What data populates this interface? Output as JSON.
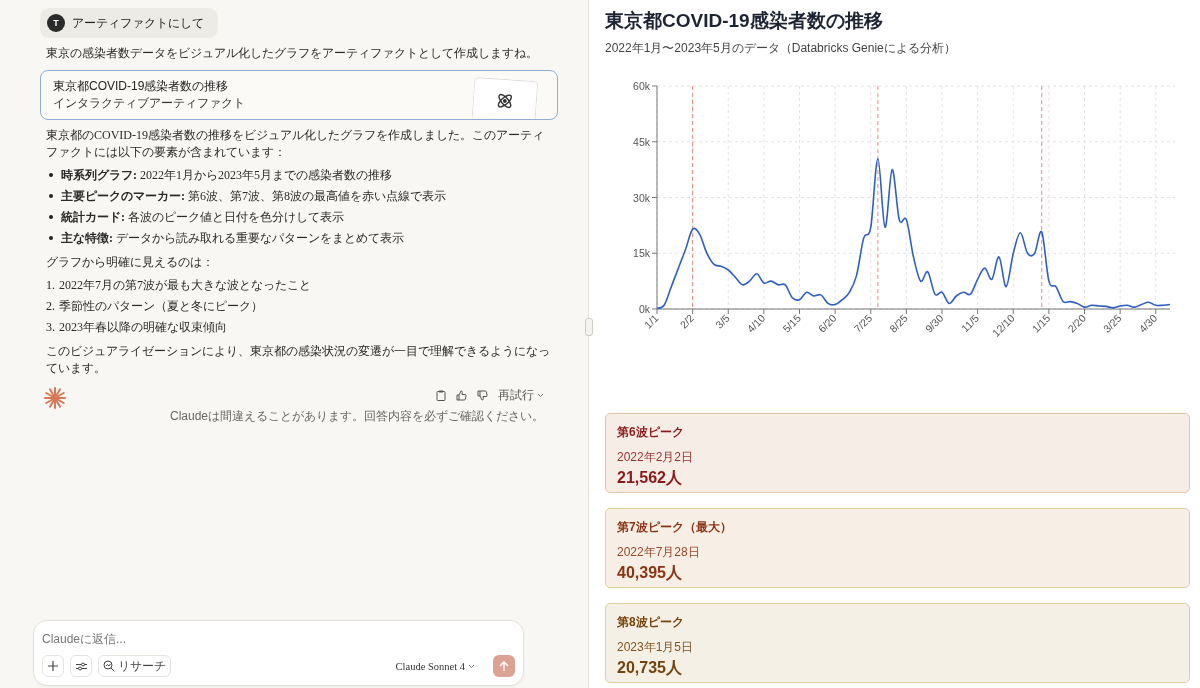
{
  "chat": {
    "user_message": {
      "avatar": "T",
      "text": "アーティファクトにして"
    },
    "assistant": {
      "intro": "東京の感染者数データをビジュアル化したグラフをアーティファクトとして作成しますね。",
      "artifact_card": {
        "title": "東京都COVID-19感染者数の推移",
        "subtitle": "インタラクティブアーティファクト"
      },
      "paragraph": "東京都のCOVID-19感染者数の推移をビジュアル化したグラフを作成しました。このアーティファクトには以下の要素が含まれています：",
      "bullets": [
        {
          "label": "時系列グラフ:",
          "text": "2022年1月から2023年5月までの感染者数の推移"
        },
        {
          "label": "主要ピークのマーカー:",
          "text": "第6波、第7波、第8波の最高値を赤い点線で表示"
        },
        {
          "label": "統計カード:",
          "text": "各波のピーク値と日付を色分けして表示"
        },
        {
          "label": "主な特徴:",
          "text": "データから読み取れる重要なパターンをまとめて表示"
        }
      ],
      "list_intro": "グラフから明確に見えるのは：",
      "numbered": [
        {
          "number": "1.",
          "text": "2022年7月の第7波が最も大きな波となったこと"
        },
        {
          "number": "2.",
          "text": "季節性のパターン（夏と冬にピーク）"
        },
        {
          "number": "3.",
          "text": "2023年春以降の明確な収束傾向"
        }
      ],
      "closing": "このビジュアライゼーションにより、東京都の感染状況の変遷が一目で理解できるようになっています。",
      "retry_label": "再試行",
      "disclaimer": "Claudeは間違えることがあります。回答内容を必ずご確認ください。"
    }
  },
  "composer": {
    "placeholder": "Claudeに返信...",
    "research_label": "リサーチ",
    "model": "Claude Sonnet 4"
  },
  "artifact": {
    "title": "東京都COVID-19感染者数の推移",
    "subtitle": "2022年1月〜2023年5月のデータ（Databricks Genieによる分析）",
    "chart_data": {
      "type": "line",
      "ylim": [
        0,
        60000
      ],
      "categories": [
        "1/1",
        null,
        null,
        null,
        null,
        "2/2",
        null,
        null,
        null,
        null,
        "3/5",
        null,
        null,
        null,
        null,
        "4/10",
        null,
        null,
        null,
        null,
        "5/15",
        null,
        null,
        null,
        null,
        "6/20",
        null,
        null,
        null,
        null,
        "7/25",
        null,
        null,
        null,
        null,
        "8/25",
        null,
        null,
        null,
        null,
        "9/30",
        null,
        null,
        null,
        null,
        "11/5",
        null,
        null,
        null,
        null,
        "12/10",
        null,
        null,
        null,
        null,
        "1/15",
        null,
        null,
        null,
        null,
        "2/20",
        null,
        null,
        null,
        null,
        "3/25",
        null,
        null,
        null,
        null,
        "4/30",
        null,
        null
      ],
      "yticks": [
        {
          "value": 0,
          "label": "0k"
        },
        {
          "value": 15000,
          "label": "15k"
        },
        {
          "value": 30000,
          "label": "30k"
        },
        {
          "value": 45000,
          "label": "45k"
        },
        {
          "value": 60000,
          "label": "60k"
        }
      ],
      "series": [
        {
          "color": "#2f5fc4",
          "values": [
            200,
            1000,
            6000,
            11000,
            16000,
            21500,
            20000,
            15000,
            12000,
            11500,
            10500,
            8500,
            6500,
            7500,
            9500,
            7000,
            7500,
            6500,
            6500,
            3000,
            2500,
            4500,
            3500,
            3800,
            1500,
            1200,
            2500,
            4500,
            9000,
            19000,
            22000,
            40400,
            22000,
            37500,
            24000,
            24000,
            14000,
            7500,
            10000,
            4000,
            4500,
            1500,
            3500,
            4500,
            4000,
            8000,
            11000,
            8000,
            14000,
            6000,
            15000,
            20500,
            15000,
            15000,
            20700,
            7500,
            6000,
            2000,
            2000,
            1500,
            500,
            1000,
            800,
            700,
            300,
            800,
            1000,
            500,
            1200,
            1800,
            1000,
            1000,
            1200
          ]
        }
      ],
      "grid": true
    },
    "peak_cards": [
      {
        "title": "第6波ピーク",
        "date": "2022年2月2日",
        "value": "21,562人",
        "color": "#8b1a1a"
      },
      {
        "title": "第7波ピーク（最大）",
        "date": "2022年7月28日",
        "value": "40,395人",
        "color": "#8a3412"
      },
      {
        "title": "第8波ピーク",
        "date": "2023年1月5日",
        "value": "20,735人",
        "color": "#74420b"
      }
    ]
  }
}
